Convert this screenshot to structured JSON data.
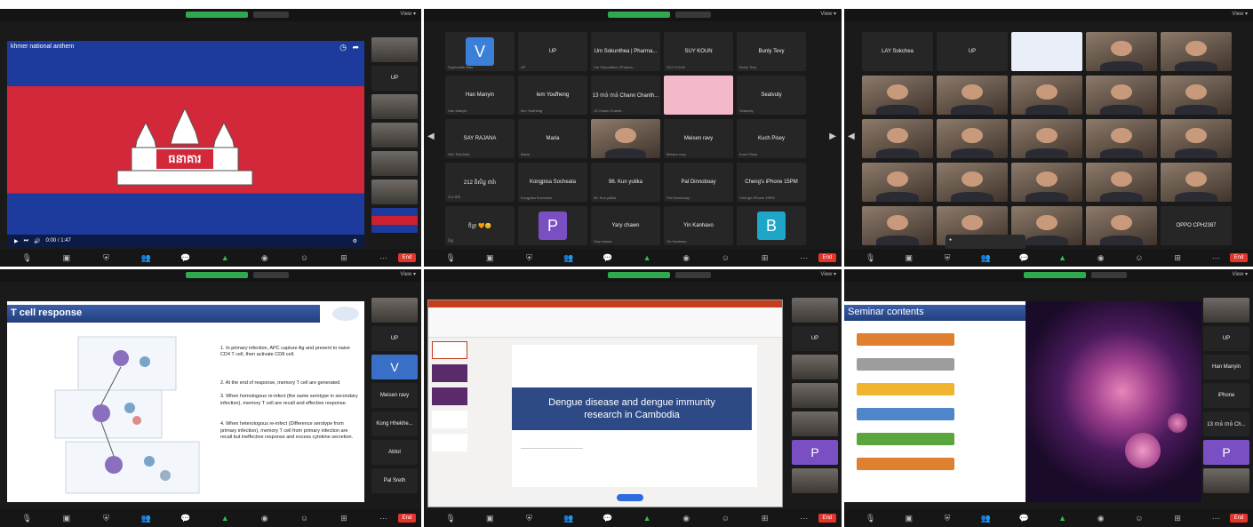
{
  "panels": {
    "p1": {
      "video_title": "khmer national anthem",
      "time": "0:00 / 1:47",
      "flag_text": "ធនាគារ",
      "sidebar": [
        "",
        "UP",
        "",
        "",
        "",
        "",
        "",
        ""
      ]
    },
    "p2": {
      "tiles": [
        {
          "label": "V",
          "sub": "Sophearak Mao",
          "kind": "letter",
          "color": "#3a80d9"
        },
        {
          "label": "UP",
          "sub": "UP"
        },
        {
          "label": "Um Sokunthea | Pharma...",
          "sub": "Um Sokunthea | Pharma..."
        },
        {
          "label": "SUY KOUN",
          "sub": "SUY KOUN"
        },
        {
          "label": "Bunly Tevy",
          "sub": "Bunly Tevy"
        },
        {
          "label": "Han Manyin",
          "sub": "Han Manyin"
        },
        {
          "label": "lem Youfheng",
          "sub": "lem Youfheng"
        },
        {
          "label": "13 ចាន់ ចាន់ Chann Chanth...",
          "sub": "13 Chann Chanth..."
        },
        {
          "label": "",
          "sub": "",
          "kind": "patrick"
        },
        {
          "label": "Seatvuty",
          "sub": "Seatvuty"
        },
        {
          "label": "SAY RAJANA",
          "sub": "SAY RAJANA"
        },
        {
          "label": "Maria",
          "sub": "Maria"
        },
        {
          "label": "",
          "sub": "",
          "kind": "cam"
        },
        {
          "label": "Meisen ravy",
          "sub": "Meisen ravy"
        },
        {
          "label": "Kuch Pisey",
          "sub": "Kuch Pisey"
        },
        {
          "label": "212 ពិសិដ្ឋ ថារ៉ា",
          "sub": "212 ថារ៉ា"
        },
        {
          "label": "Kongpisa Socheata",
          "sub": "Kongpisa Socheata"
        },
        {
          "label": "96. Kun yutika",
          "sub": "96. Kun yutika"
        },
        {
          "label": "Pal Dinnoboay",
          "sub": "Pal Dinnoboay"
        },
        {
          "label": "Cheng's iPhone 15PM",
          "sub": "Cheng's iPhone 15PM"
        },
        {
          "label": "ចិន្តា 🧡😊",
          "sub": "ចិន្តា"
        },
        {
          "label": "P",
          "sub": "",
          "kind": "letter",
          "color": "#7a4fc4"
        },
        {
          "label": "Yary chawn",
          "sub": "Yary chawn"
        },
        {
          "label": "Yin Kanhavo",
          "sub": "Yin Kanhavo"
        },
        {
          "label": "B",
          "sub": "",
          "kind": "letter",
          "color": "#1ea6c8"
        }
      ]
    },
    "p3": {
      "tiles": [
        {
          "label": "LAY Sokchea"
        },
        {
          "label": "UP"
        },
        {
          "label": "",
          "kind": "slide"
        },
        {
          "label": "",
          "kind": "cam"
        },
        {
          "label": "",
          "kind": "cam"
        },
        {
          "label": "",
          "kind": "cam"
        },
        {
          "label": "",
          "kind": "cam"
        },
        {
          "label": "",
          "kind": "cam"
        },
        {
          "label": "",
          "kind": "cam"
        },
        {
          "label": "",
          "kind": "cam"
        },
        {
          "label": "",
          "kind": "cam"
        },
        {
          "label": "",
          "kind": "cam"
        },
        {
          "label": "",
          "kind": "cam"
        },
        {
          "label": "",
          "kind": "cam"
        },
        {
          "label": "",
          "kind": "cam"
        },
        {
          "label": "",
          "kind": "cam"
        },
        {
          "label": "",
          "kind": "cam"
        },
        {
          "label": "",
          "kind": "cam"
        },
        {
          "label": "",
          "kind": "cam"
        },
        {
          "label": "",
          "kind": "cam"
        },
        {
          "label": "",
          "kind": "cam"
        },
        {
          "label": "",
          "kind": "cam"
        },
        {
          "label": "",
          "kind": "cam"
        },
        {
          "label": "",
          "kind": "cam"
        },
        {
          "label": "OPPO CPH2387"
        }
      ]
    },
    "p4": {
      "slide_title": "T cell response",
      "points": [
        "1. In primary infection, APC capture Ag and present to naive CD4 T cell, then activate CD8 cell.",
        "2. At the end of response, memory T cell are generated",
        "3. When homologous re-infect (the same serotype in secondary infection), memory T cell are recall and effective response.",
        "4. When heterologous re-infect (Difference serotype from primary infection), memory T cell from primary infection are recall but ineffective response and excess cytokine secretion."
      ],
      "sidebar": [
        "",
        "UP",
        "V",
        "Meisen ravy",
        "Kong Hhekhe...",
        "Abtol",
        "Pal Sreth"
      ]
    },
    "p5": {
      "slide_title": "Dengue disease and dengue immunity research in Cambodia",
      "sidebar": [
        "",
        "UP",
        "",
        "",
        "",
        "P",
        ""
      ]
    },
    "p6": {
      "slide_title": "Seminar contents",
      "sidebar": [
        "",
        "UP",
        "Han Manyin",
        "iPhone",
        "13 ចាន់ ចាន់ Ch...",
        "P",
        ""
      ]
    }
  },
  "toolbar": {
    "end": "End"
  }
}
